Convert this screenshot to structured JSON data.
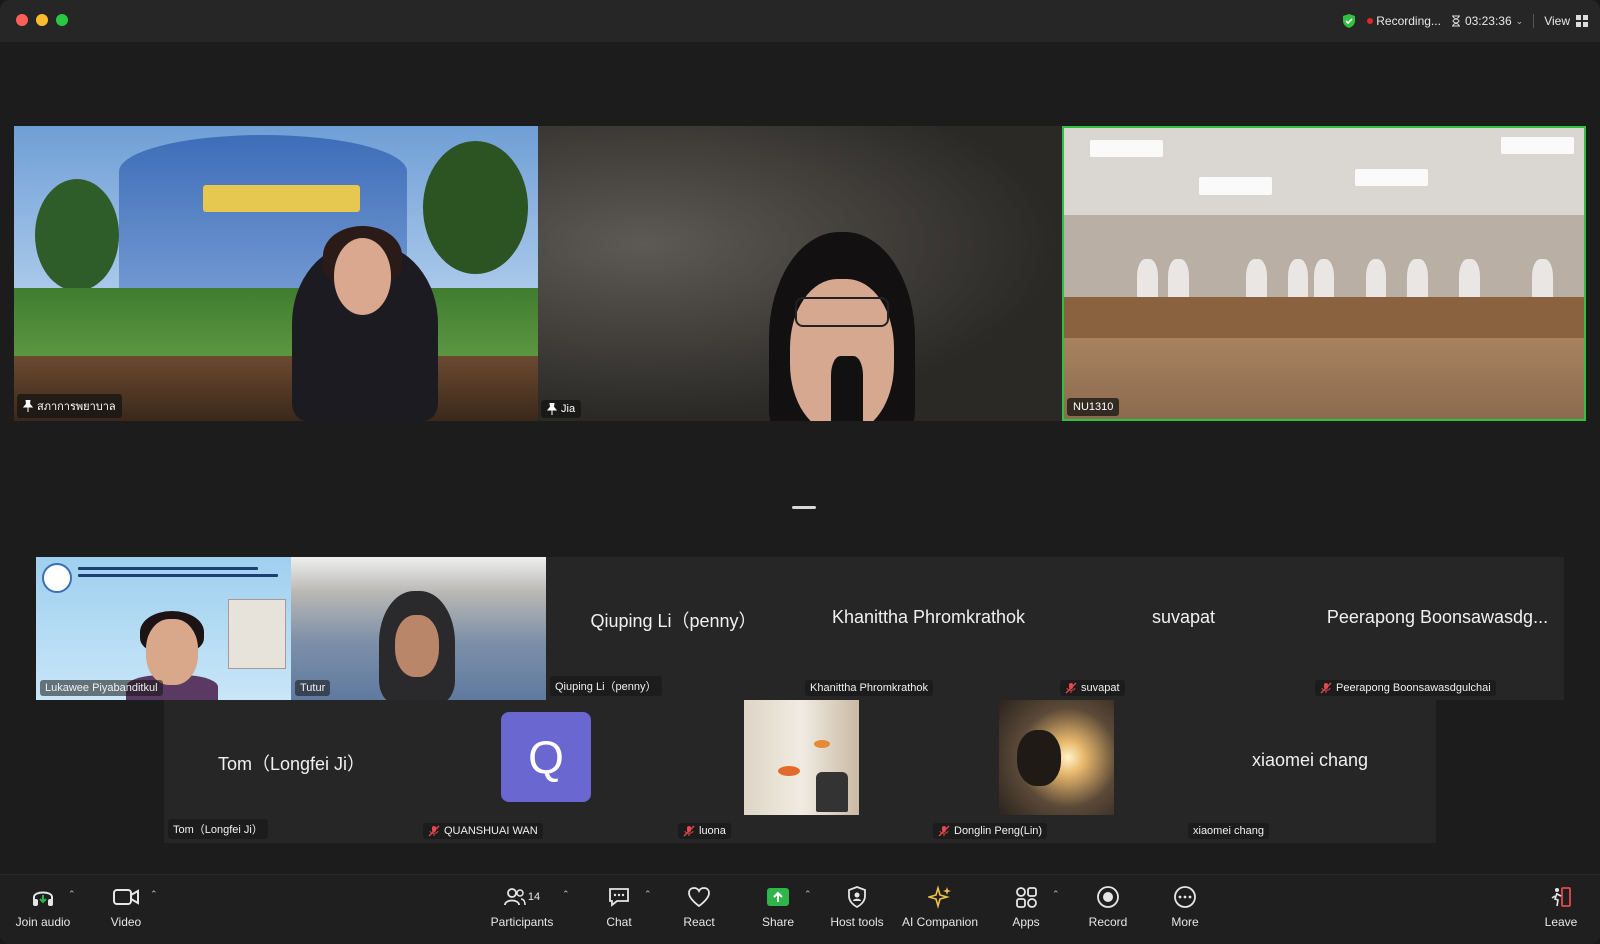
{
  "titlebar": {
    "recording_label": "Recording...",
    "timer": "03:23:36",
    "view_label": "View"
  },
  "speakers": [
    {
      "name": "สภาการพยาบาล",
      "pinned": true
    },
    {
      "name": "Jia",
      "pinned": true
    },
    {
      "name": "NU1310",
      "pinned": false,
      "active": true
    }
  ],
  "gallery": {
    "row1": [
      {
        "name": "Lukawee Piyabanditkul",
        "video": true
      },
      {
        "name": "Tutur",
        "video": true
      },
      {
        "name": "Qiuping Li（penny）",
        "display": "Qiuping Li（penny）",
        "video": false
      },
      {
        "name": "Khanittha Phromkrathok",
        "display": "Khanittha Phromkrathok",
        "video": false
      },
      {
        "name": "suvapat",
        "display": "suvapat",
        "video": false,
        "muted": true
      },
      {
        "name": "Peerapong Boonsawasdgulchai",
        "display": "Peerapong Boonsawasdg...",
        "video": false,
        "muted": true
      }
    ],
    "row2": [
      {
        "name": "Tom（Longfei Ji）",
        "display": "Tom（Longfei Ji）",
        "video": false
      },
      {
        "name": "QUANSHUAI WAN",
        "avatar_letter": "Q",
        "muted": true
      },
      {
        "name": "luona",
        "thumb": true,
        "muted": true
      },
      {
        "name": "Donglin Peng(Lin)",
        "thumb": true,
        "muted": true
      },
      {
        "name": "xiaomei chang",
        "display": "xiaomei chang",
        "video": false
      }
    ]
  },
  "toolbar": {
    "join_audio": "Join audio",
    "video": "Video",
    "participants": "Participants",
    "participants_count": "14",
    "chat": "Chat",
    "react": "React",
    "share": "Share",
    "host_tools": "Host tools",
    "ai_companion": "AI Companion",
    "apps": "Apps",
    "record": "Record",
    "more": "More",
    "leave": "Leave"
  },
  "colors": {
    "active_speaker_border": "#2fc13f",
    "share_green": "#2fb54a",
    "record_red": "#e02828",
    "avatar_purple": "#6b67d0",
    "leave_red": "#e5484d"
  }
}
